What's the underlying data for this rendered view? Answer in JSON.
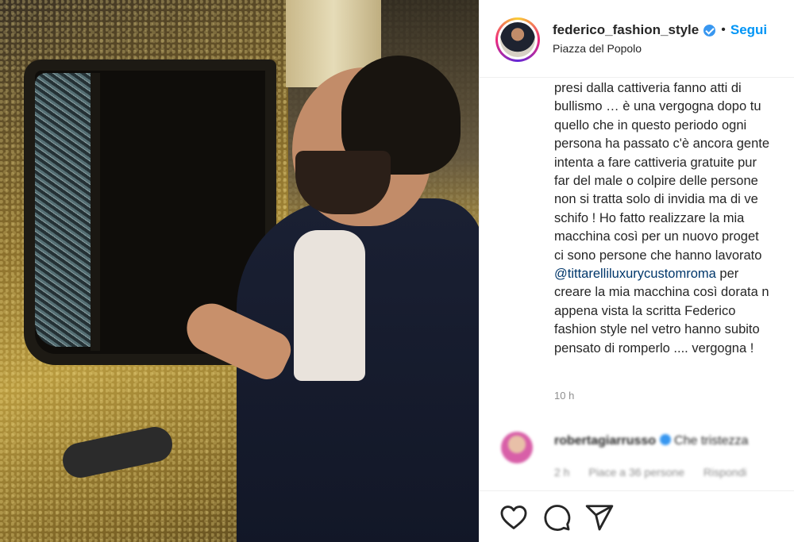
{
  "post": {
    "username": "federico_fashion_style",
    "separator": "•",
    "follow_label": "Segui",
    "location": "Piazza del Popolo",
    "caption_lines": [
      "presi dalla cattiveria fanno atti di",
      "bullismo … è una vergogna dopo tu",
      "quello che in questo periodo ogni",
      "persona ha passato c'è ancora gente",
      "intenta a fare cattiveria gratuite pur",
      "far del male o colpire delle persone",
      "non si tratta solo di invidia ma di ve",
      "schifo ! Ho fatto realizzare la mia",
      "macchina così per un nuovo proget",
      "ci sono persone che hanno lavorato"
    ],
    "caption_mention": "@tittarelliluxurycustomroma",
    "caption_mention_tail": " per",
    "caption_lines_after": [
      "creare la mia macchina così dorata n",
      "appena vista la scritta Federico",
      "fashion style nel vetro hanno subito",
      "pensato di romperlo .... vergogna !"
    ],
    "time_ago": "10 h"
  },
  "comment": {
    "username": "robertagiarrusso",
    "text": "Che tristezza",
    "time": "2 h",
    "likes": "Piace a 36 persone",
    "reply": "Rispondi"
  },
  "actions": {
    "icons": [
      "heart-icon",
      "comment-icon",
      "share-icon"
    ]
  },
  "colors": {
    "accent": "#0095f6",
    "verified": "#3897f0",
    "mention": "#00376b",
    "muted": "#8e8e8e"
  }
}
